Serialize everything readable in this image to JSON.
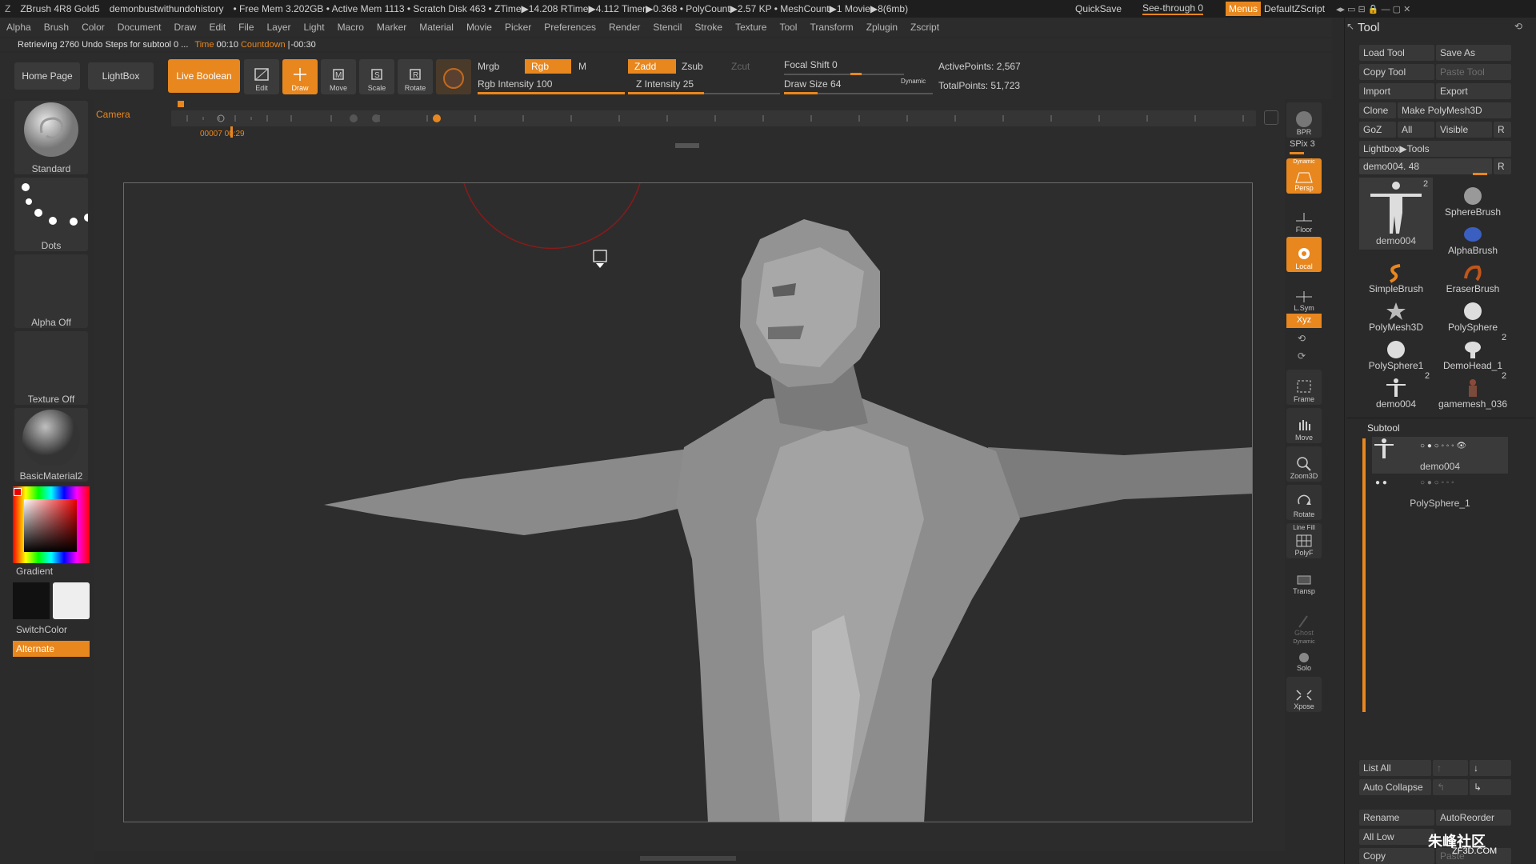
{
  "titlebar": {
    "app": "ZBrush 4R8 Gold5",
    "doc": "demonbustwithundohistory",
    "stats": "• Free Mem 3.202GB • Active Mem 1113 • Scratch Disk 463 • ZTime▶14.208 RTime▶4.112 Timer▶0.368 • PolyCount▶2.57 KP • MeshCount▶1 Movie▶8(6mb)",
    "quicksave": "QuickSave",
    "seethrough": "See-through",
    "seethrough_value": "0",
    "menus": "Menus",
    "script": "DefaultZScript"
  },
  "menus": [
    "Alpha",
    "Brush",
    "Color",
    "Document",
    "Draw",
    "Edit",
    "File",
    "Layer",
    "Light",
    "Macro",
    "Marker",
    "Material",
    "Movie",
    "Picker",
    "Preferences",
    "Render",
    "Stencil",
    "Stroke",
    "Texture",
    "Tool",
    "Transform",
    "Zplugin",
    "Zscript"
  ],
  "status": {
    "message": "Retrieving 2760 Undo Steps for subtool 0 ...",
    "time_label": "Time",
    "time_value": "00:10",
    "countdown_label": "Countdown",
    "countdown_value": "-00:30"
  },
  "toolbar": {
    "home": "Home Page",
    "lightbox": "LightBox",
    "liveboolean": "Live Boolean",
    "edit": "Edit",
    "draw": "Draw",
    "move": "Move",
    "scale": "Scale",
    "rotate": "Rotate",
    "mrgb": "Mrgb",
    "rgb": "Rgb",
    "m": "M",
    "rgb_intensity": "Rgb Intensity 100",
    "zadd": "Zadd",
    "zsub": "Zsub",
    "zcut": "Zcut",
    "z_intensity": "Z Intensity 25",
    "focal_shift": "Focal Shift 0",
    "draw_size": "Draw Size 64",
    "dynamic": "Dynamic",
    "active_points": "ActivePoints: 2,567",
    "total_points": "TotalPoints: 51,723"
  },
  "timeline": {
    "camera": "Camera",
    "time_a": "00007",
    "time_b": "00:29"
  },
  "leftshelf": {
    "brush": "Standard",
    "stroke": "Dots",
    "alpha": "Alpha Off",
    "texture": "Texture Off",
    "material": "BasicMaterial2",
    "gradient": "Gradient",
    "switchcolor": "SwitchColor",
    "alternate": "Alternate"
  },
  "rightshelf": {
    "bpr": "BPR",
    "spix": "SPix 3",
    "dynamic": "Dynamic",
    "persp": "Persp",
    "floor": "Floor",
    "local": "Local",
    "lsym": "L.Sym",
    "xyz": "Xyz",
    "frame": "Frame",
    "move": "Move",
    "zoom3d": "Zoom3D",
    "rotate": "Rotate",
    "linefill": "Line Fill",
    "polyf": "PolyF",
    "transp": "Transp",
    "ghost": "Ghost",
    "solo_dynamic": "Dynamic",
    "solo": "Solo",
    "xpose": "Xpose"
  },
  "toolpanel": {
    "title": "Tool",
    "load": "Load Tool",
    "saveas": "Save As",
    "copy": "Copy Tool",
    "paste": "Paste Tool",
    "import": "Import",
    "export": "Export",
    "clone": "Clone",
    "make_polymesh": "Make PolyMesh3D",
    "goz": "GoZ",
    "all": "All",
    "visible": "Visible",
    "r": "R",
    "lightbox_tools": "Lightbox▶Tools",
    "current": "demo004. 48",
    "r2": "R",
    "thumbs": [
      {
        "label": "demo004",
        "badge": "2"
      },
      {
        "label": "SphereBrush",
        "badge": ""
      },
      {
        "label": "AlphaBrush",
        "badge": ""
      },
      {
        "label": "SimpleBrush",
        "badge": ""
      },
      {
        "label": "EraserBrush",
        "badge": ""
      },
      {
        "label": "PolyMesh3D",
        "badge": ""
      },
      {
        "label": "PolySphere",
        "badge": ""
      },
      {
        "label": "PolySphere1",
        "badge": ""
      },
      {
        "label": "DemoHead_1",
        "badge": "2"
      },
      {
        "label": "demo004",
        "badge": "2"
      },
      {
        "label": "gamemesh_036",
        "badge": "2"
      }
    ],
    "subtool_title": "Subtool",
    "subtools": [
      "demo004",
      "PolySphere_1"
    ],
    "listall": "List All",
    "autocollapse": "Auto Collapse",
    "rename": "Rename",
    "autoreorder": "AutoReorder",
    "alllow": "All Low",
    "copy2": "Copy",
    "paste2": "Paste"
  },
  "watermark": "ZF3D.COM",
  "watermark_cn": "朱峰社区",
  "colors": {
    "accent": "#e8871e",
    "bg": "#2a2a2a"
  }
}
